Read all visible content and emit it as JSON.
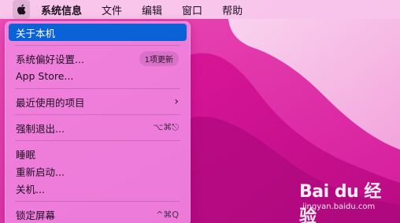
{
  "menubar": {
    "apple_icon": "apple-logo-icon",
    "app_name": "系统信息",
    "items": [
      "文件",
      "编辑",
      "窗口",
      "帮助"
    ]
  },
  "apple_menu": {
    "about": "关于本机",
    "system_prefs": "系统偏好设置...",
    "system_prefs_badge": "1项更新",
    "app_store": "App Store...",
    "recent_items": "最近使用的项目",
    "force_quit": "强制退出...",
    "force_quit_shortcut": "⌥⌘⎋",
    "sleep": "睡眠",
    "restart": "重新启动...",
    "shutdown": "关机...",
    "lock_screen": "锁定屏幕",
    "lock_screen_shortcut": "^⌘Q"
  },
  "watermark": {
    "logo": "Bai du 经验",
    "url": "jingyan.baidu.com"
  },
  "colors": {
    "highlight": "#0b62d6",
    "wallpaper_dark": "#c70e92",
    "wallpaper_light": "#f5b7e3"
  }
}
